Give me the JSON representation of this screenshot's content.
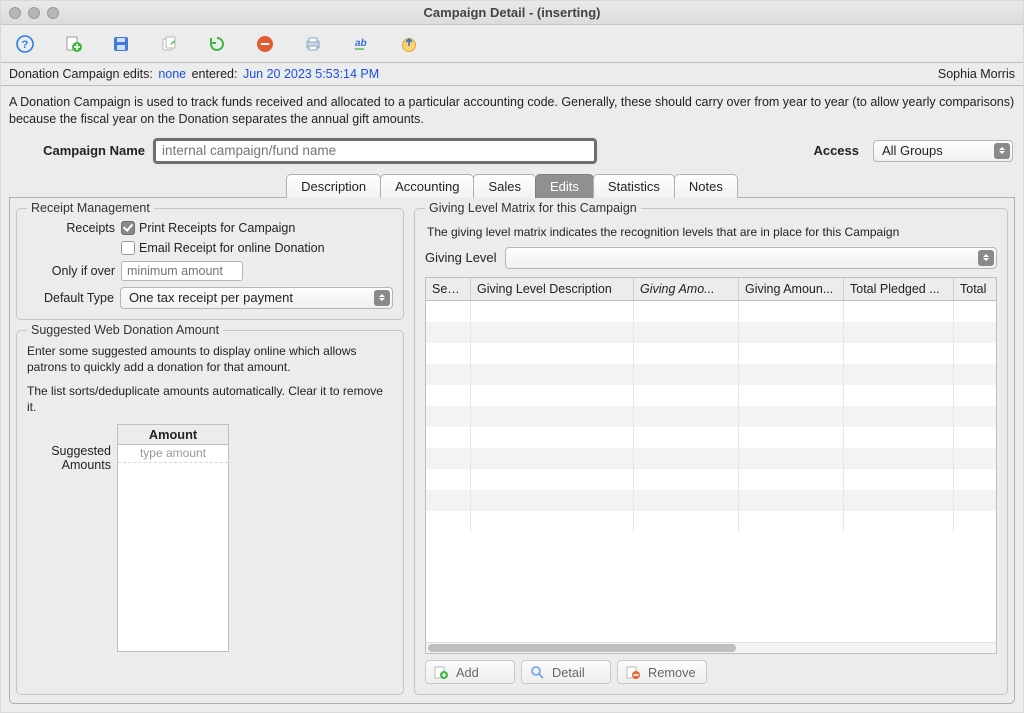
{
  "window": {
    "title": "Campaign Detail -  (inserting)"
  },
  "status": {
    "prefix": "Donation Campaign edits: ",
    "edits": "none",
    "entered_label": "  entered: ",
    "entered": "Jun 20 2023 5:53:14 PM",
    "user": "Sophia Morris"
  },
  "help": "A Donation Campaign is used to track funds received and allocated to a particular accounting code.  Generally, these should carry over from year to year (to allow yearly comparisons) because the fiscal year on the Donation separates the annual gift amounts.",
  "name_row": {
    "label": "Campaign Name",
    "placeholder": "internal campaign/fund name",
    "access_label": "Access",
    "access_value": "All Groups"
  },
  "tabs": [
    "Description",
    "Accounting",
    "Sales",
    "Edits",
    "Statistics",
    "Notes"
  ],
  "active_tab": "Edits",
  "receipt": {
    "legend": "Receipt Management",
    "receipts_label": "Receipts",
    "print_label": "Print Receipts for Campaign",
    "email_label": "Email Receipt for online Donation",
    "only_if_over_label": "Only if over",
    "only_if_over_placeholder": "minimum amount",
    "default_type_label": "Default Type",
    "default_type_value": "One tax receipt per payment"
  },
  "suggested": {
    "legend": "Suggested Web Donation Amount",
    "desc1": "Enter some suggested amounts to display online which allows patrons to quickly add a donation for that amount.",
    "desc2": "The list sorts/deduplicate amounts automatically. Clear it to remove it.",
    "label": "Suggested Amounts",
    "column": "Amount",
    "placeholder": "type amount"
  },
  "matrix": {
    "legend": "Giving Level Matrix for this Campaign",
    "desc": "The giving level matrix indicates the recognition levels that are in place for this Campaign",
    "giving_label": "Giving Level",
    "giving_value": "",
    "columns": [
      "Seq #",
      "Giving Level Description",
      "Giving Amo...",
      "Giving Amoun...",
      "Total Pledged ...",
      "Total"
    ],
    "buttons": {
      "add": "Add",
      "detail": "Detail",
      "remove": "Remove"
    }
  }
}
